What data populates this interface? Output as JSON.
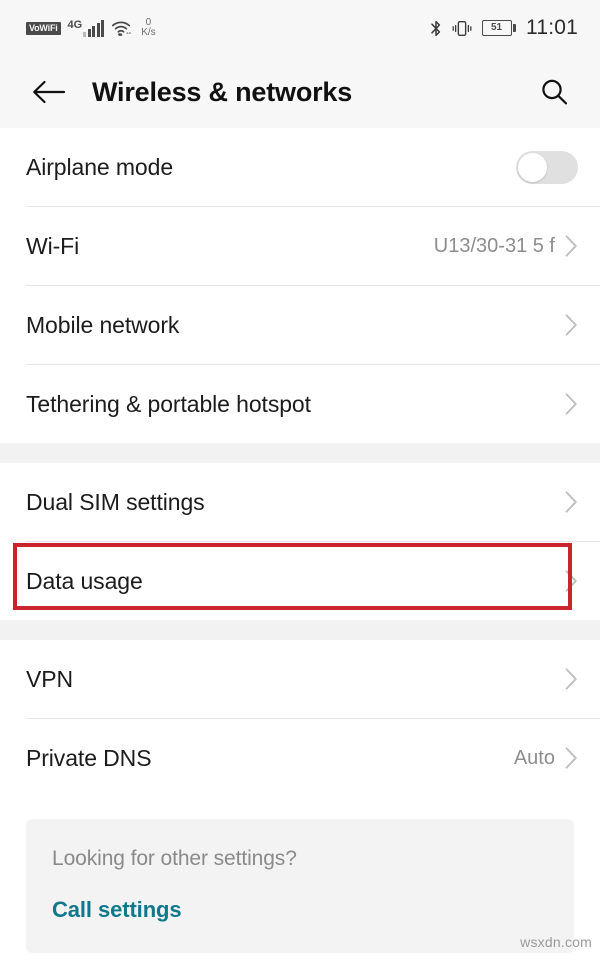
{
  "status_bar": {
    "vowifi_badge": "VoWiFi",
    "network_type": "4G",
    "signal_bars": 5,
    "data_speed_value": "0",
    "data_speed_unit": "K/s",
    "battery_percent": "51",
    "time": "11:01",
    "icons": [
      "wifi-icon",
      "bluetooth-icon",
      "vibrate-icon",
      "battery-icon"
    ]
  },
  "app_bar": {
    "back_icon": "back-arrow-icon",
    "title": "Wireless & networks",
    "search_icon": "search-icon"
  },
  "sections": [
    {
      "rows": [
        {
          "label": "Airplane mode",
          "value": "",
          "control": "toggle",
          "toggle_on": false,
          "highlighted": false
        },
        {
          "label": "Wi-Fi",
          "value": "U13/30-31 5 f",
          "control": "chevron",
          "highlighted": false
        },
        {
          "label": "Mobile network",
          "value": "",
          "control": "chevron",
          "highlighted": false
        },
        {
          "label": "Tethering & portable hotspot",
          "value": "",
          "control": "chevron",
          "highlighted": false
        }
      ]
    },
    {
      "rows": [
        {
          "label": "Dual SIM settings",
          "value": "",
          "control": "chevron",
          "highlighted": false
        },
        {
          "label": "Data usage",
          "value": "",
          "control": "chevron",
          "highlighted": true
        }
      ]
    },
    {
      "rows": [
        {
          "label": "VPN",
          "value": "",
          "control": "chevron",
          "highlighted": false
        },
        {
          "label": "Private DNS",
          "value": "Auto",
          "control": "chevron",
          "highlighted": false
        }
      ]
    }
  ],
  "footer": {
    "question": "Looking for other settings?",
    "link": "Call settings"
  },
  "watermark": "wsxdn.com",
  "colors": {
    "highlight": "#c9252d",
    "link": "#11788c",
    "header_bg": "#f7f7f7",
    "section_gap": "#f2f2f2",
    "value_text": "#8d8d8d"
  }
}
